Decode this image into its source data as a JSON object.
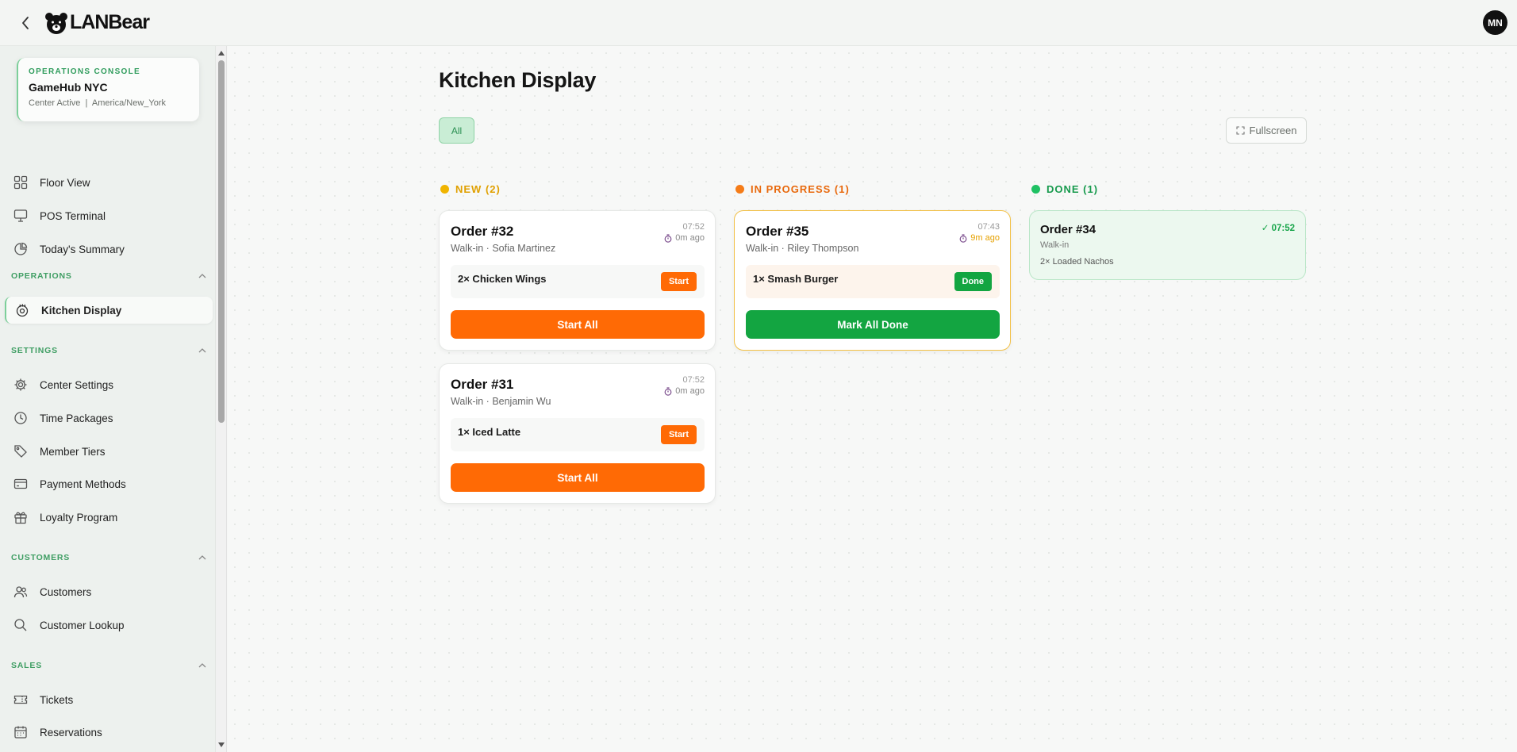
{
  "app": {
    "brand": "LANBear"
  },
  "user": {
    "initials": "MN"
  },
  "console": {
    "eyebrow": "OPERATIONS CONSOLE",
    "center_name": "GameHub NYC",
    "status_line": "Center Active  |  America/New_York"
  },
  "sidebar": {
    "top_items": [
      {
        "label": "Floor View",
        "icon": "grid-icon"
      },
      {
        "label": "POS Terminal",
        "icon": "monitor-icon"
      },
      {
        "label": "Today's Summary",
        "icon": "pie-chart-icon"
      }
    ],
    "sections": {
      "operations": {
        "title": "OPERATIONS",
        "items": [
          {
            "label": "Kitchen Display",
            "icon": "cooking-icon",
            "active": true
          }
        ]
      },
      "settings": {
        "title": "SETTINGS",
        "items": [
          {
            "label": "Center Settings",
            "icon": "gear-icon"
          },
          {
            "label": "Time Packages",
            "icon": "clock-icon"
          },
          {
            "label": "Member Tiers",
            "icon": "tag-icon"
          },
          {
            "label": "Payment Methods",
            "icon": "credit-card-icon"
          },
          {
            "label": "Loyalty Program",
            "icon": "gift-icon"
          }
        ]
      },
      "customers": {
        "title": "CUSTOMERS",
        "items": [
          {
            "label": "Customers",
            "icon": "users-icon"
          },
          {
            "label": "Customer Lookup",
            "icon": "search-icon"
          }
        ]
      },
      "sales": {
        "title": "SALES",
        "items": [
          {
            "label": "Tickets",
            "icon": "ticket-icon"
          },
          {
            "label": "Reservations",
            "icon": "calendar-icon"
          }
        ]
      }
    }
  },
  "main": {
    "title": "Kitchen Display",
    "filter_all": "All",
    "fullscreen": "Fullscreen",
    "columns": {
      "new": {
        "label": "NEW (2)",
        "color": "#f0b400",
        "text_color": "#e0a000"
      },
      "in_progress": {
        "label": "IN PROGRESS (1)",
        "color": "#f57c18",
        "text_color": "#e8690d"
      },
      "done": {
        "label": "DONE (1)",
        "color": "#1fc163",
        "text_color": "#179a4d"
      }
    },
    "orders": {
      "o32": {
        "title": "Order #32",
        "sub": "Walk-in · Sofia Martinez",
        "time": "07:52",
        "ago": "0m ago",
        "item": "2× Chicken Wings",
        "item_btn": "Start",
        "action": "Start All"
      },
      "o31": {
        "title": "Order #31",
        "sub": "Walk-in · Benjamin Wu",
        "time": "07:52",
        "ago": "0m ago",
        "item": "1× Iced Latte",
        "item_btn": "Start",
        "action": "Start All"
      },
      "o35": {
        "title": "Order #35",
        "sub": "Walk-in · Riley Thompson",
        "time": "07:43",
        "ago": "9m ago",
        "item": "1× Smash Burger",
        "item_btn": "Done",
        "action": "Mark All Done"
      },
      "o34": {
        "title": "Order #34",
        "sub": "Walk-in",
        "time": "✓ 07:52",
        "item": "2× Loaded Nachos"
      }
    }
  }
}
